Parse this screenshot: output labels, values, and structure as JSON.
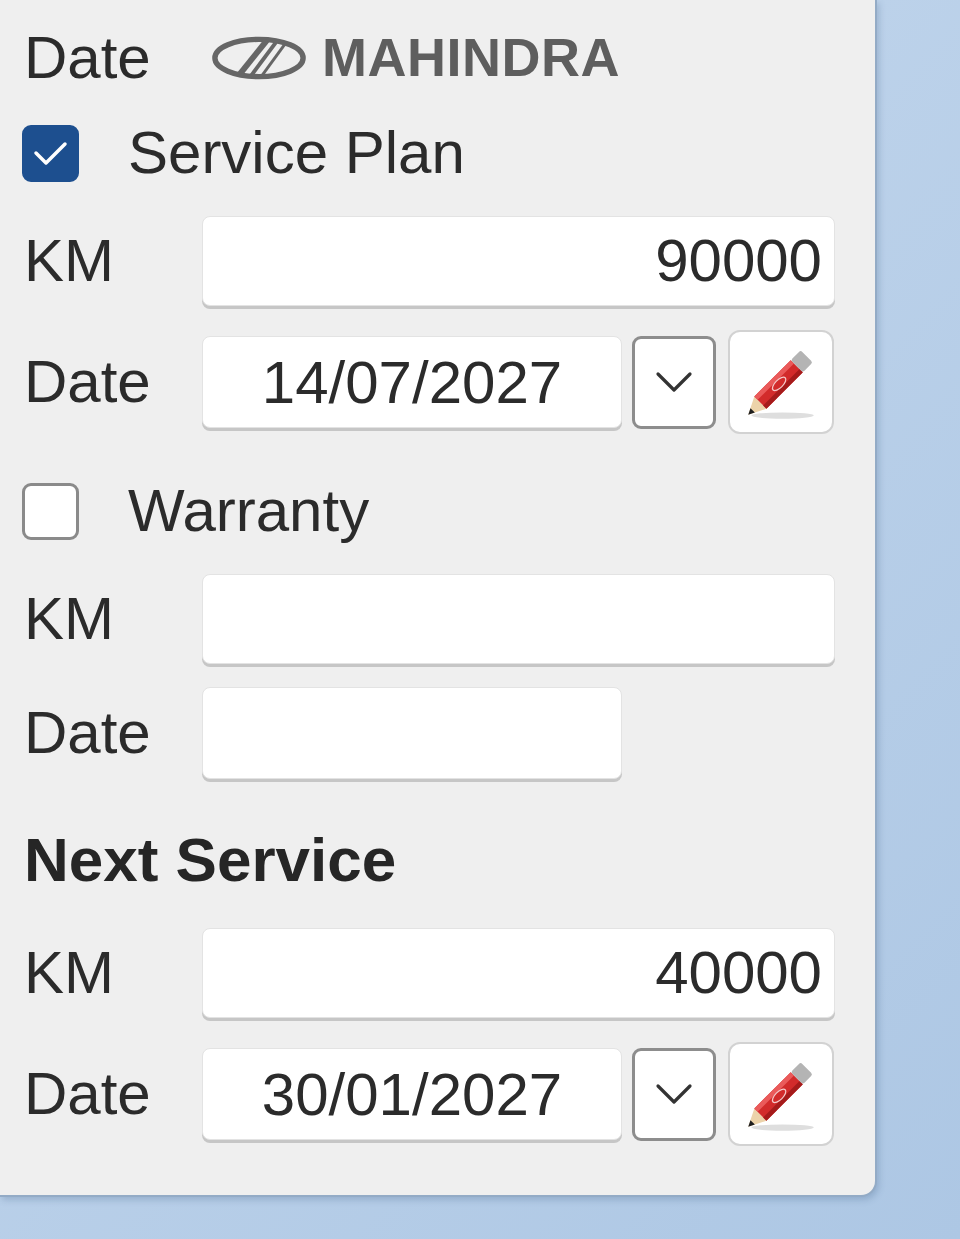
{
  "header": {
    "label": "Date",
    "brand": "MAHINDRA"
  },
  "sections": [
    {
      "kind": "checkbox",
      "title": "Service Plan",
      "checked": true,
      "fields": [
        {
          "kind": "number",
          "label": "KM",
          "value": "90000"
        },
        {
          "kind": "date",
          "label": "Date",
          "value": "14/07/2027"
        }
      ]
    },
    {
      "kind": "checkbox",
      "title": "Warranty",
      "checked": false,
      "fields": [
        {
          "kind": "number",
          "label": "KM"
        },
        {
          "kind": "date-blank",
          "label": "Date"
        }
      ]
    },
    {
      "kind": "heading",
      "title": "Next Service",
      "fields": [
        {
          "kind": "number",
          "label": "KM",
          "value": "40000"
        },
        {
          "kind": "date",
          "label": "Date",
          "value": "30/01/2027"
        }
      ]
    }
  ]
}
